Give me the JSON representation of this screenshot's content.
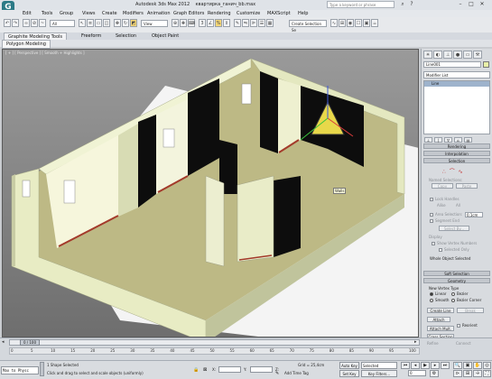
{
  "title_bar": {
    "app_title": "Autodesk 3ds Max 2012",
    "file_name": "квартирка_ганич_bb.max",
    "search_placeholder": "Type a keyword or phrase"
  },
  "menu": [
    "Edit",
    "Tools",
    "Group",
    "Views",
    "Create",
    "Modifiers",
    "Animation",
    "Graph Editors",
    "Rendering",
    "Customize",
    "MAXScript",
    "Help"
  ],
  "toolbar": {
    "filter_dropdown": "All",
    "view_dropdown": "View",
    "selection_set": "Create Selection Se"
  },
  "ribbon": {
    "tabs": [
      "Graphite Modeling Tools",
      "Freeform",
      "Selection",
      "Object Paint"
    ],
    "active_tab": "Graphite Modeling Tools",
    "sub_label": "Polygon Modeling"
  },
  "viewport": {
    "label": "[ + ] [ Perspective ] [ Smooth + Highlights ]",
    "cursor_tooltip": "Walls"
  },
  "command_panel": {
    "object_name": "Line001",
    "modifier_list": "Modifier List",
    "stack_item": "Line",
    "rollouts": [
      "Rendering",
      "Interpolation",
      "Selection",
      "Soft Selection",
      "Geometry"
    ],
    "selection": {
      "named_selections": "Named Selections:",
      "copy": "Copy",
      "paste": "Paste",
      "lock_handles": "Lock Handles",
      "alike": "Alike",
      "all": "All",
      "area_selection": "Area Selection:",
      "area_value": "0,1cm",
      "segment_end": "Segment End",
      "select_by": "Select By...",
      "display": "Display",
      "show_vertex_numbers": "Show Vertex Numbers",
      "selected_only": "Selected Only",
      "status": "Whole Object Selected"
    },
    "geometry": {
      "new_vertex_type": "New Vertex Type",
      "linear": "Linear",
      "bezier": "Bezier",
      "smooth": "Smooth",
      "bezier_corner": "Bezier Corner",
      "create_line": "Create Line",
      "break": "Break",
      "attach": "Attach",
      "reorient": "Reorient",
      "attach_mult": "Attach Mult.",
      "cross_section": "Cross Section",
      "refine": "Refine",
      "connect": "Connect"
    }
  },
  "timeline": {
    "position": "0 / 100",
    "ticks": [
      "0",
      "5",
      "10",
      "15",
      "20",
      "25",
      "30",
      "35",
      "40",
      "45",
      "50",
      "55",
      "60",
      "65",
      "70",
      "75",
      "80",
      "85",
      "90",
      "95",
      "100"
    ]
  },
  "status": {
    "script_text": "Max to Physc",
    "line1": "1 Shape Selected",
    "line2": "Click and drag to select and scale objects (uniformly)",
    "x": "X:",
    "y": "Y:",
    "z_label": "Z:",
    "grid": "Grid = 25,4cm",
    "auto_key": "Auto Key",
    "selected": "Selected",
    "set_key": "Set Key",
    "key_filters": "Key Filters...",
    "add_time_tag": "Add Time Tag",
    "frame": "0"
  }
}
